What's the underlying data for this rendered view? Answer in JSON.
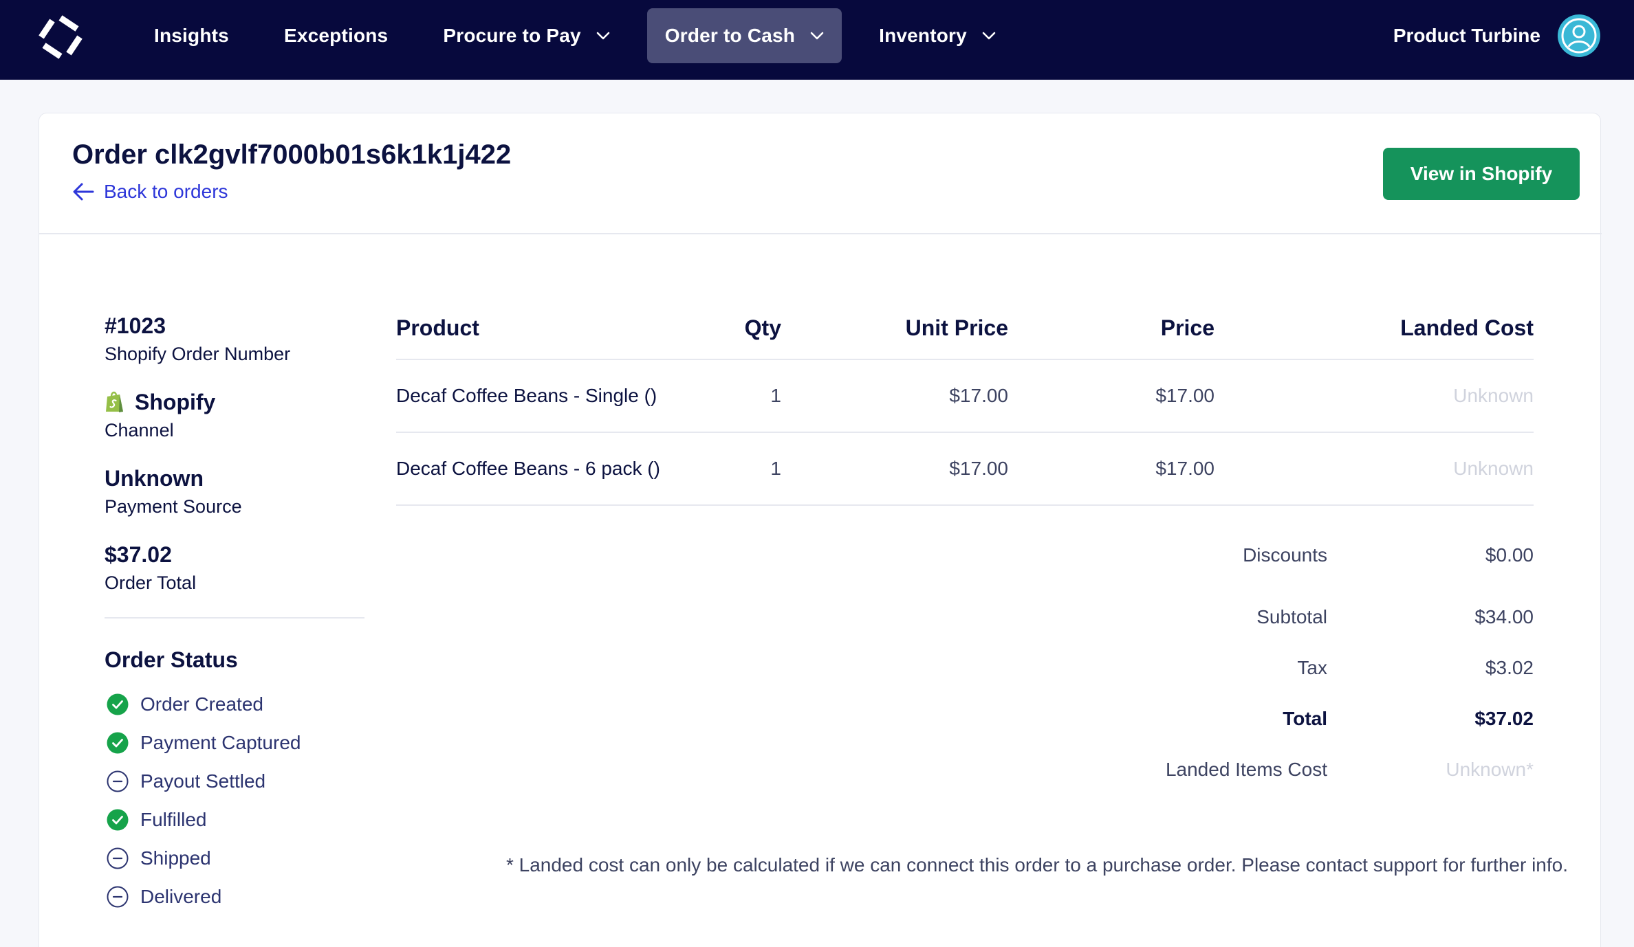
{
  "nav": {
    "items": [
      {
        "label": "Insights",
        "has_dropdown": false,
        "active": false
      },
      {
        "label": "Exceptions",
        "has_dropdown": false,
        "active": false
      },
      {
        "label": "Procure to Pay",
        "has_dropdown": true,
        "active": false
      },
      {
        "label": "Order to Cash",
        "has_dropdown": true,
        "active": true
      },
      {
        "label": "Inventory",
        "has_dropdown": true,
        "active": false
      }
    ],
    "org_name": "Product Turbine",
    "icons": {
      "logo": "turbine-logo-icon",
      "avatar": "user-avatar-icon",
      "chevron": "chevron-down-icon"
    }
  },
  "header": {
    "title": "Order clk2gvlf7000b01s6k1k1j422",
    "back_label": "Back to orders",
    "view_button": "View in Shopify"
  },
  "summary": {
    "order_number": "#1023",
    "order_number_label": "Shopify Order Number",
    "channel": "Shopify",
    "channel_label": "Channel",
    "payment_source": "Unknown",
    "payment_source_label": "Payment Source",
    "order_total": "$37.02",
    "order_total_label": "Order Total"
  },
  "status": {
    "title": "Order Status",
    "items": [
      {
        "label": "Order Created",
        "done": true
      },
      {
        "label": "Payment Captured",
        "done": true
      },
      {
        "label": "Payout Settled",
        "done": false
      },
      {
        "label": "Fulfilled",
        "done": true
      },
      {
        "label": "Shipped",
        "done": false
      },
      {
        "label": "Delivered",
        "done": false
      }
    ]
  },
  "table": {
    "columns": [
      "Product",
      "Qty",
      "Unit Price",
      "Price",
      "Landed Cost"
    ],
    "rows": [
      {
        "product": "Decaf Coffee Beans - Single ()",
        "qty": "1",
        "unit_price": "$17.00",
        "price": "$17.00",
        "landed_cost": "Unknown"
      },
      {
        "product": "Decaf Coffee Beans - 6 pack ()",
        "qty": "1",
        "unit_price": "$17.00",
        "price": "$17.00",
        "landed_cost": "Unknown"
      }
    ]
  },
  "totals": {
    "discounts_label": "Discounts",
    "discounts": "$0.00",
    "subtotal_label": "Subtotal",
    "subtotal": "$34.00",
    "tax_label": "Tax",
    "tax": "$3.02",
    "total_label": "Total",
    "total": "$37.02",
    "landed_label": "Landed Items Cost",
    "landed": "Unknown*"
  },
  "footnote": "* Landed cost can only be calculated if we can connect this order to a purchase order. Please contact support for further info.",
  "colors": {
    "nav_bg": "#07093d",
    "nav_active": "#4a4d77",
    "primary_green": "#15935b",
    "link_blue": "#2d36d9",
    "avatar_teal": "#3ab8d6",
    "check_green": "#16a34a"
  }
}
